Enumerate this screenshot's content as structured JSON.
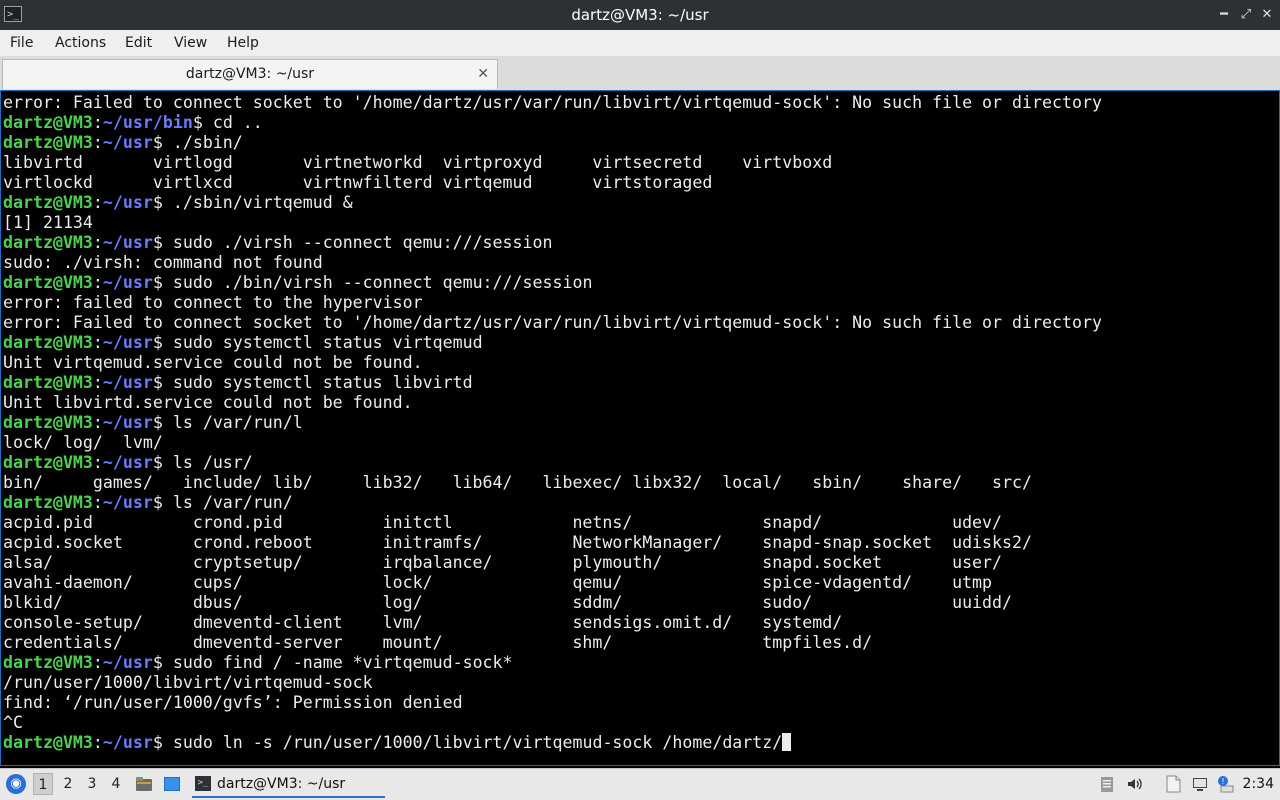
{
  "window": {
    "app_icon": ">_",
    "title": "dartz@VM3: ~/usr",
    "buttons": {
      "minimize": "━",
      "maximize": "⤢",
      "close": "✕"
    }
  },
  "menubar": {
    "items": [
      "File",
      "Actions",
      "Edit",
      "View",
      "Help"
    ]
  },
  "tab": {
    "label": "dartz@VM3: ~/usr",
    "close": "✕"
  },
  "prompt": {
    "user": "dartz@VM3",
    "sep": ":",
    "dir_prefix": "~/usr"
  },
  "terminal_lines": [
    {
      "type": "out",
      "text": "error: Failed to connect socket to '/home/dartz/usr/var/run/libvirt/virtqemud-sock': No such file or directory"
    },
    {
      "type": "cmd",
      "dir": "~/usr/bin",
      "cmd": "$ cd .."
    },
    {
      "type": "cmd",
      "dir": "~/usr",
      "cmd": "$ ./sbin/"
    },
    {
      "type": "out",
      "text": "libvirtd       virtlogd       virtnetworkd  virtproxyd     virtsecretd    virtvboxd"
    },
    {
      "type": "out",
      "text": "virtlockd      virtlxcd       virtnwfilterd virtqemud      virtstoraged"
    },
    {
      "type": "cmd",
      "dir": "~/usr",
      "cmd": "$ ./sbin/virtqemud &"
    },
    {
      "type": "out",
      "text": "[1] 21134"
    },
    {
      "type": "cmd",
      "dir": "~/usr",
      "cmd": "$ sudo ./virsh --connect qemu:///session"
    },
    {
      "type": "out",
      "text": "sudo: ./virsh: command not found"
    },
    {
      "type": "cmd",
      "dir": "~/usr",
      "cmd": "$ sudo ./bin/virsh --connect qemu:///session"
    },
    {
      "type": "out",
      "text": "error: failed to connect to the hypervisor"
    },
    {
      "type": "out",
      "text": "error: Failed to connect socket to '/home/dartz/usr/var/run/libvirt/virtqemud-sock': No such file or directory"
    },
    {
      "type": "cmd",
      "dir": "~/usr",
      "cmd": "$ sudo systemctl status virtqemud"
    },
    {
      "type": "out",
      "text": "Unit virtqemud.service could not be found."
    },
    {
      "type": "cmd",
      "dir": "~/usr",
      "cmd": "$ sudo systemctl status libvirtd"
    },
    {
      "type": "out",
      "text": "Unit libvirtd.service could not be found."
    },
    {
      "type": "cmd",
      "dir": "~/usr",
      "cmd": "$ ls /var/run/l"
    },
    {
      "type": "out",
      "text": "lock/ log/  lvm/"
    },
    {
      "type": "cmd",
      "dir": "~/usr",
      "cmd": "$ ls /usr/"
    },
    {
      "type": "out",
      "text": "bin/     games/   include/ lib/     lib32/   lib64/   libexec/ libx32/  local/   sbin/    share/   src/"
    },
    {
      "type": "cmd",
      "dir": "~/usr",
      "cmd": "$ ls /var/run/"
    },
    {
      "type": "out",
      "text": "acpid.pid          crond.pid          initctl            netns/             snapd/             udev/"
    },
    {
      "type": "out",
      "text": "acpid.socket       crond.reboot       initramfs/         NetworkManager/    snapd-snap.socket  udisks2/"
    },
    {
      "type": "out",
      "text": "alsa/              cryptsetup/        irqbalance/        plymouth/          snapd.socket       user/"
    },
    {
      "type": "out",
      "text": "avahi-daemon/      cups/              lock/              qemu/              spice-vdagentd/    utmp"
    },
    {
      "type": "out",
      "text": "blkid/             dbus/              log/               sddm/              sudo/              uuidd/"
    },
    {
      "type": "out",
      "text": "console-setup/     dmeventd-client    lvm/               sendsigs.omit.d/   systemd/"
    },
    {
      "type": "out",
      "text": "credentials/       dmeventd-server    mount/             shm/               tmpfiles.d/"
    },
    {
      "type": "cmd",
      "dir": "~/usr",
      "cmd": "$ sudo find / -name *virtqemud-sock*"
    },
    {
      "type": "out",
      "text": "/run/user/1000/libvirt/virtqemud-sock"
    },
    {
      "type": "out",
      "text": "find: ‘/run/user/1000/gvfs’: Permission denied"
    },
    {
      "type": "out",
      "text": "^C"
    },
    {
      "type": "cmd",
      "dir": "~/usr",
      "cmd": "$ sudo ln -s /run/user/1000/libvirt/virtqemud-sock /home/dartz/",
      "cursor": true
    }
  ],
  "taskbar": {
    "start_icon": "start-menu-icon",
    "workspaces": [
      "1",
      "2",
      "3",
      "4"
    ],
    "active_workspace": "1",
    "task_label": "dartz@VM3: ~/usr",
    "task_icon": ">_",
    "clock": "2:34",
    "accent": "#2a6fd6"
  },
  "colors": {
    "prompt_user": "#4ed24e",
    "prompt_dir": "#6b7cff",
    "terminal_bg": "#000000",
    "terminal_fg": "#ececec"
  }
}
